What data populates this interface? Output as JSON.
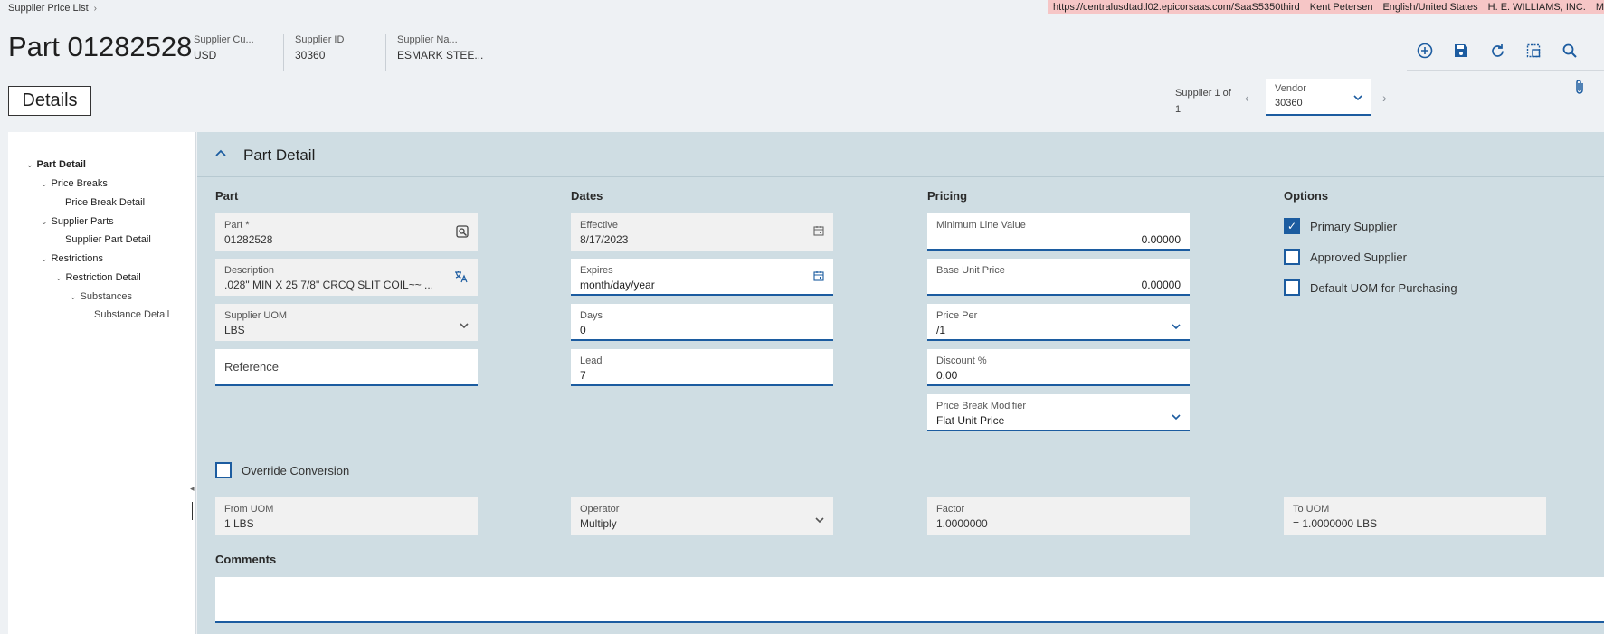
{
  "breadcrumb": {
    "label": "Supplier Price List"
  },
  "env": {
    "url": "https://centralusdtadtl02.epicorsaas.com/SaaS5350third",
    "user": "Kent Petersen",
    "locale": "English/United States",
    "company": "H. E. WILLIAMS, INC.",
    "extra": "M"
  },
  "header": {
    "title": "Part 01282528",
    "fields": [
      {
        "label": "Supplier Cu...",
        "value": "USD"
      },
      {
        "label": "Supplier ID",
        "value": "30360"
      },
      {
        "label": "Supplier Na...",
        "value": "ESMARK STEE..."
      }
    ]
  },
  "toolbar": {
    "icons": [
      "add-icon",
      "save-icon",
      "refresh-icon",
      "layout-icon",
      "search-icon",
      "attachment-icon"
    ]
  },
  "details_tab": {
    "label": "Details"
  },
  "supplier_nav": {
    "line1": "Supplier 1 of",
    "line2": "1",
    "vendor_label": "Vendor",
    "vendor_value": "30360"
  },
  "tree": [
    {
      "label": "Part Detail",
      "level": 0,
      "bold": true
    },
    {
      "label": "Price Breaks",
      "level": 1
    },
    {
      "label": "Price Break Detail",
      "level": 2
    },
    {
      "label": "Supplier Parts",
      "level": 1
    },
    {
      "label": "Supplier Part Detail",
      "level": 2
    },
    {
      "label": "Restrictions",
      "level": 1
    },
    {
      "label": "Restriction Detail",
      "level": 2
    },
    {
      "label": "Substances",
      "level": 3
    },
    {
      "label": "Substance Detail",
      "level": 4
    }
  ],
  "section": {
    "title": "Part Detail"
  },
  "groups": {
    "part": "Part",
    "dates": "Dates",
    "pricing": "Pricing",
    "options": "Options"
  },
  "part": {
    "part_label": "Part *",
    "part_value": "01282528",
    "desc_label": "Description",
    "desc_value": ".028\" MIN X 25 7/8\" CRCQ SLIT COIL~~  ...",
    "uom_label": "Supplier UOM",
    "uom_value": "LBS",
    "reference_placeholder": "Reference"
  },
  "dates": {
    "effective_label": "Effective",
    "effective_value": "8/17/2023",
    "expires_label": "Expires",
    "expires_value": "month/day/year",
    "days_label": "Days",
    "days_value": "0",
    "lead_label": "Lead",
    "lead_value": "7"
  },
  "pricing": {
    "min_line_label": "Minimum Line Value",
    "min_line_value": "0.00000",
    "base_price_label": "Base Unit Price",
    "base_price_value": "0.00000",
    "price_per_label": "Price Per",
    "price_per_value": "/1",
    "discount_label": "Discount %",
    "discount_value": "0.00",
    "modifier_label": "Price Break Modifier",
    "modifier_value": "Flat Unit Price"
  },
  "options": {
    "primary": {
      "label": "Primary Supplier",
      "checked": true
    },
    "approved": {
      "label": "Approved Supplier",
      "checked": false
    },
    "default_uom": {
      "label": "Default UOM for Purchasing",
      "checked": false
    }
  },
  "conversion": {
    "override_label": "Override Conversion",
    "from_label": "From UOM",
    "from_value": "1 LBS",
    "operator_label": "Operator",
    "operator_value": "Multiply",
    "factor_label": "Factor",
    "factor_value": "1.0000000",
    "to_label": "To UOM",
    "to_value": "= 1.0000000 LBS"
  },
  "comments": {
    "label": "Comments"
  },
  "colors": {
    "accent": "#1c5ca0",
    "panel": "#cfdde3",
    "env_banner": "#f6c6c6"
  }
}
